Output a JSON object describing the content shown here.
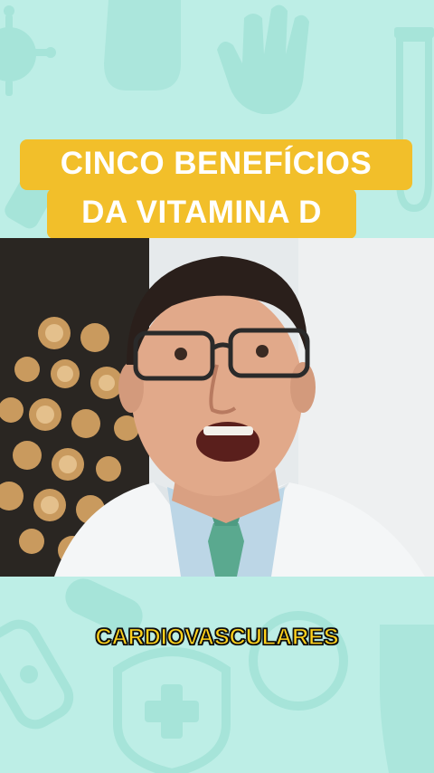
{
  "title": {
    "line1": "CINCO BENEFÍCIOS",
    "line2": "DA VITAMINA D"
  },
  "caption": {
    "text": "CARDIOVASCULARES"
  },
  "colors": {
    "background": "#bdeee6",
    "icon_tint": "#9fe0d5",
    "title_bg": "#f2bf2a",
    "title_text": "#ffffff",
    "caption_fill": "#ffd21c",
    "caption_outline": "#111111"
  },
  "icons": [
    "virus-icon",
    "glove-icon",
    "hand-icon",
    "test-tube-icon",
    "syringe-icon",
    "bandage-icon",
    "pill-icon",
    "cross-shield-icon",
    "stethoscope-icon"
  ]
}
